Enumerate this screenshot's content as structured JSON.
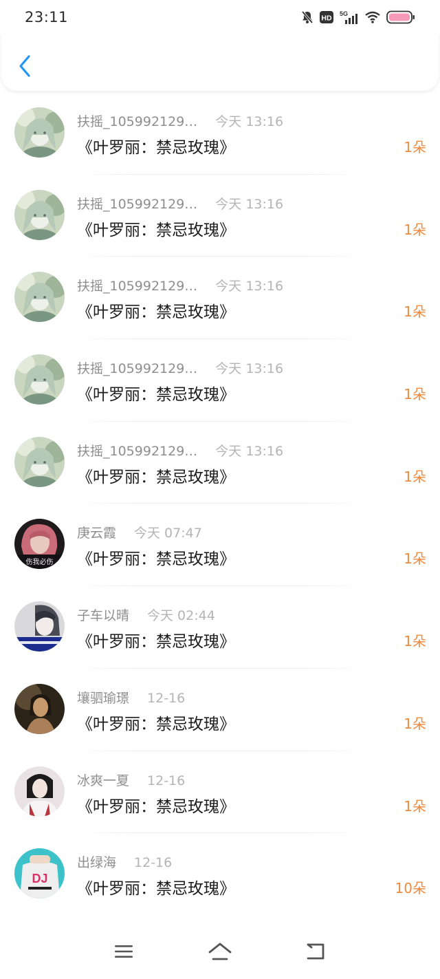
{
  "status_bar": {
    "time": "23:11",
    "icons": [
      "mute-bell-icon",
      "hd-icon",
      "5g-signal-icon",
      "wifi-icon",
      "battery-icon"
    ],
    "hd_label": "HD",
    "network_label": "5G"
  },
  "header": {
    "back_icon": "chevron-left-icon",
    "accent_color": "#2196f3"
  },
  "records": [
    {
      "user": "扶摇_105992129…",
      "time": "今天 13:16",
      "work": "《叶罗丽：禁忌玫瑰》",
      "count": "1朵",
      "avatar": "avatar-a"
    },
    {
      "user": "扶摇_105992129…",
      "time": "今天 13:16",
      "work": "《叶罗丽：禁忌玫瑰》",
      "count": "1朵",
      "avatar": "avatar-a"
    },
    {
      "user": "扶摇_105992129…",
      "time": "今天 13:16",
      "work": "《叶罗丽：禁忌玫瑰》",
      "count": "1朵",
      "avatar": "avatar-a"
    },
    {
      "user": "扶摇_105992129…",
      "time": "今天 13:16",
      "work": "《叶罗丽：禁忌玫瑰》",
      "count": "1朵",
      "avatar": "avatar-a"
    },
    {
      "user": "扶摇_105992129…",
      "time": "今天 13:16",
      "work": "《叶罗丽：禁忌玫瑰》",
      "count": "1朵",
      "avatar": "avatar-a"
    },
    {
      "user": "庚云霞",
      "time": "今天 07:47",
      "work": "《叶罗丽：禁忌玫瑰》",
      "count": "1朵",
      "avatar": "avatar-b",
      "avatar_caption": "伤我必伤"
    },
    {
      "user": "子车以晴",
      "time": "今天 02:44",
      "work": "《叶罗丽：禁忌玫瑰》",
      "count": "1朵",
      "avatar": "avatar-c"
    },
    {
      "user": "壤驷瑜璟",
      "time": "12-16",
      "work": "《叶罗丽：禁忌玫瑰》",
      "count": "1朵",
      "avatar": "avatar-d"
    },
    {
      "user": "冰爽一夏",
      "time": "12-16",
      "work": "《叶罗丽：禁忌玫瑰》",
      "count": "1朵",
      "avatar": "avatar-e"
    },
    {
      "user": "出绿海",
      "time": "12-16",
      "work": "《叶罗丽：禁忌玫瑰》",
      "count": "10朵",
      "avatar": "avatar-f",
      "avatar_caption": "DJ"
    }
  ],
  "colors": {
    "count": "#f08a3c",
    "username": "#8e8e8e",
    "time": "#b4b4b4",
    "title": "#1e1e1e",
    "battery": "#f49ab8"
  },
  "nav_bar": {
    "icons": [
      "menu-icon",
      "home-icon",
      "back-icon"
    ]
  }
}
